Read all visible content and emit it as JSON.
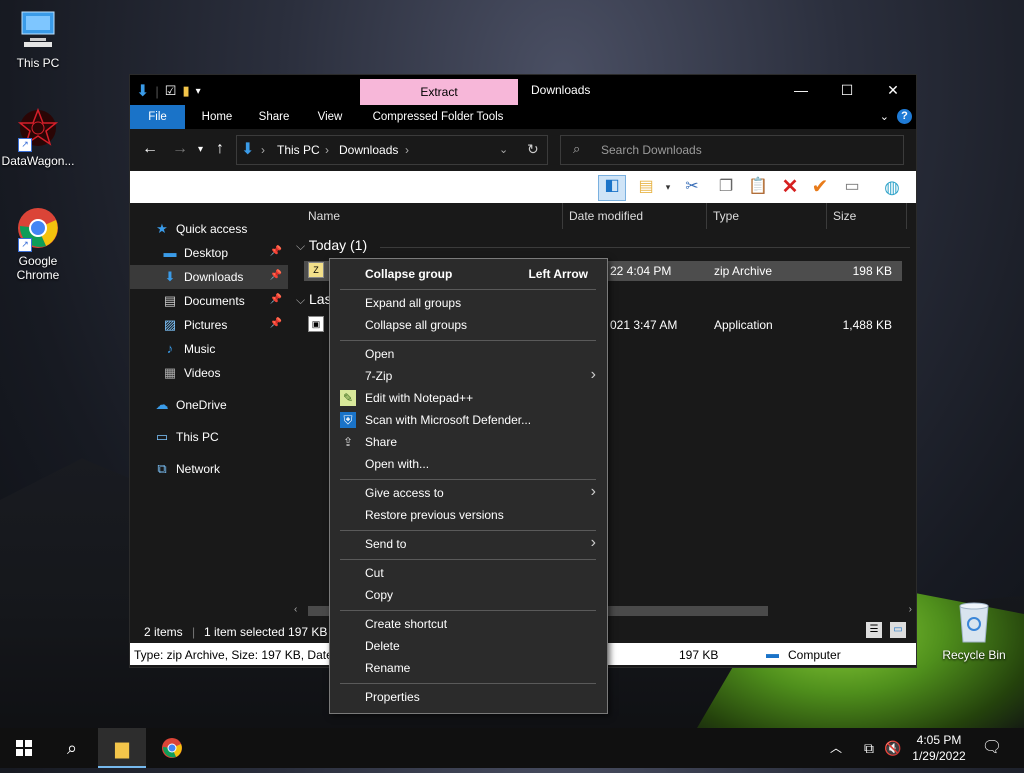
{
  "desktop": {
    "icons": [
      {
        "label": "This PC",
        "icon": "this-pc-icon"
      },
      {
        "label": "DataWagon...",
        "icon": "datawagon-icon"
      },
      {
        "label": "Google Chrome",
        "icon": "chrome-icon"
      },
      {
        "label": "Recycle Bin",
        "icon": "recycle-bin-icon"
      }
    ]
  },
  "window": {
    "title": "Downloads",
    "contextual_tab": "Extract",
    "ribbon_tabs": [
      "File",
      "Home",
      "Share",
      "View",
      "Compressed Folder Tools"
    ],
    "controls": {
      "minimize": "—",
      "maximize": "☐",
      "close": "✕"
    },
    "help": "?"
  },
  "address": {
    "crumbs": [
      "This PC",
      "Downloads"
    ],
    "search_placeholder": "Search Downloads"
  },
  "nav": {
    "items": [
      {
        "label": "Quick access",
        "icon": "star-icon",
        "pinned": false
      },
      {
        "label": "Desktop",
        "icon": "desktop-icon",
        "pinned": true
      },
      {
        "label": "Downloads",
        "icon": "download-icon",
        "pinned": true
      },
      {
        "label": "Documents",
        "icon": "documents-icon",
        "pinned": true
      },
      {
        "label": "Pictures",
        "icon": "pictures-icon",
        "pinned": true
      },
      {
        "label": "Music",
        "icon": "music-icon",
        "pinned": false
      },
      {
        "label": "Videos",
        "icon": "videos-icon",
        "pinned": false
      },
      {
        "label": "OneDrive",
        "icon": "cloud-icon",
        "pinned": false
      },
      {
        "label": "This PC",
        "icon": "computer-icon",
        "pinned": false
      },
      {
        "label": "Network",
        "icon": "network-icon",
        "pinned": false
      }
    ]
  },
  "columns": [
    "Name",
    "Date modified",
    "Type",
    "Size"
  ],
  "groups": [
    {
      "label": "Today (1)",
      "collapse_icon": "chevron-down-icon"
    },
    {
      "label": "Las",
      "collapse_icon": "chevron-down-icon"
    }
  ],
  "rows": [
    {
      "date": "22 4:04 PM",
      "type": "zip Archive",
      "size": "198 KB",
      "selected": true
    },
    {
      "date": "021 3:47 AM",
      "type": "Application",
      "size": "1,488 KB",
      "selected": false
    }
  ],
  "status": {
    "items": "2 items",
    "selected": "1 item selected  197 KB"
  },
  "info": {
    "text": "Type: zip Archive, Size: 197 KB, Date m",
    "size": "197 KB",
    "location": "Computer"
  },
  "context_menu": {
    "items": [
      {
        "label": "Collapse group",
        "shortcut": "Left Arrow",
        "bold": true
      },
      {
        "sep": true
      },
      {
        "label": "Expand all groups"
      },
      {
        "label": "Collapse all groups"
      },
      {
        "sep": true
      },
      {
        "label": "Open"
      },
      {
        "label": "7-Zip",
        "submenu": true
      },
      {
        "label": "Edit with Notepad++",
        "icon": "notepadpp-icon"
      },
      {
        "label": "Scan with Microsoft Defender...",
        "icon": "defender-icon"
      },
      {
        "label": "Share",
        "icon": "share-icon"
      },
      {
        "label": "Open with..."
      },
      {
        "sep": true
      },
      {
        "label": "Give access to",
        "submenu": true
      },
      {
        "label": "Restore previous versions"
      },
      {
        "sep": true
      },
      {
        "label": "Send to",
        "submenu": true
      },
      {
        "sep": true
      },
      {
        "label": "Cut"
      },
      {
        "label": "Copy"
      },
      {
        "sep": true
      },
      {
        "label": "Create shortcut"
      },
      {
        "label": "Delete"
      },
      {
        "label": "Rename"
      },
      {
        "sep": true
      },
      {
        "label": "Properties"
      }
    ]
  },
  "taskbar": {
    "time": "4:05 PM",
    "date": "1/29/2022"
  }
}
